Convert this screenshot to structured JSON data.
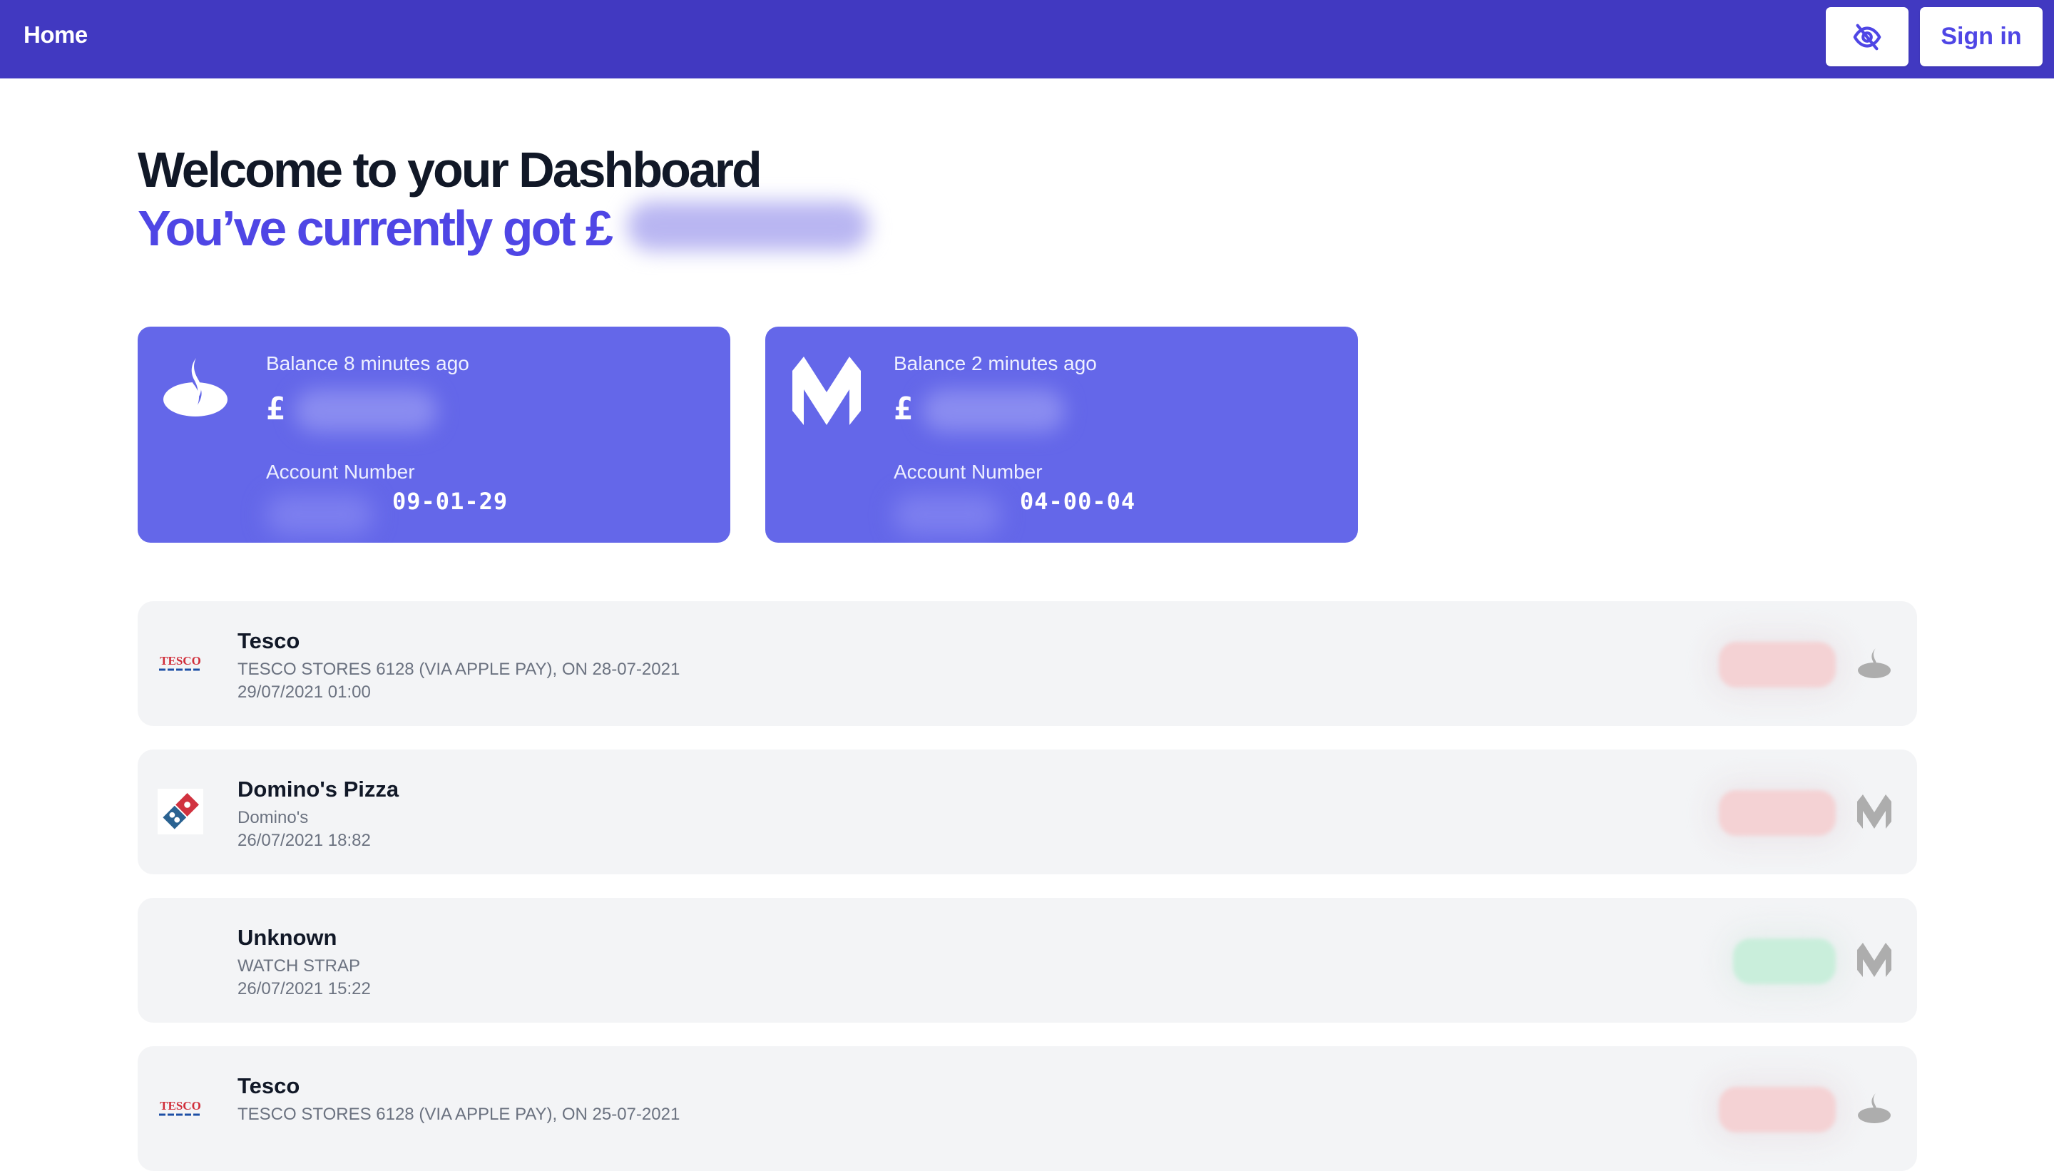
{
  "header": {
    "home_label": "Home",
    "hide_balance_icon": "eye-off-icon",
    "signin_label": "Sign in",
    "bg_color": "#4139c1"
  },
  "hero": {
    "title": "Welcome to your Dashboard",
    "subtitle": "You’ve currently got £",
    "total_amount": "hidden (blurred)"
  },
  "accounts": [
    {
      "bank": "Santander",
      "logo_icon": "santander-flame-icon",
      "balance_label": "Balance 8 minutes ago",
      "currency_symbol": "£",
      "balance": "hidden (blurred)",
      "account_number_label": "Account Number",
      "account_number": "hidden (blurred)",
      "sort_code": "09-01-29"
    },
    {
      "bank": "Monzo",
      "logo_icon": "monzo-m-icon",
      "balance_label": "Balance 2 minutes ago",
      "currency_symbol": "£",
      "balance": "hidden (blurred)",
      "account_number_label": "Account Number",
      "account_number": "hidden (blurred)",
      "sort_code": "04-00-04"
    }
  ],
  "transactions": [
    {
      "merchant": "Tesco",
      "logo_icon": "tesco-logo",
      "logo_text": "TESCO",
      "description": "TESCO STORES 6128 (VIA APPLE PAY), ON 28-07-2021",
      "datetime": "29/07/2021 01:00",
      "amount": "hidden (blurred)",
      "direction": "debit",
      "bank_icon": "santander-flame-icon"
    },
    {
      "merchant": "Domino's Pizza",
      "logo_icon": "dominos-logo",
      "logo_text": "",
      "description": "Domino's",
      "datetime": "26/07/2021 18:82",
      "amount": "hidden (blurred)",
      "direction": "debit",
      "bank_icon": "monzo-m-icon"
    },
    {
      "merchant": "Unknown",
      "logo_icon": "",
      "logo_text": "",
      "description": "WATCH STRAP",
      "datetime": "26/07/2021 15:22",
      "amount": "hidden (blurred)",
      "direction": "credit",
      "bank_icon": "monzo-m-icon"
    },
    {
      "merchant": "Tesco",
      "logo_icon": "tesco-logo",
      "logo_text": "TESCO",
      "description": "TESCO STORES 6128 (VIA APPLE PAY), ON 25-07-2021",
      "datetime": "",
      "amount": "hidden (blurred)",
      "direction": "debit",
      "bank_icon": "santander-flame-icon"
    }
  ],
  "colors": {
    "accent": "#4f46e5",
    "card_bg": "#6467e9",
    "row_bg": "#f3f4f6",
    "debit": "#f4d2d4",
    "credit": "#c9eedb"
  }
}
